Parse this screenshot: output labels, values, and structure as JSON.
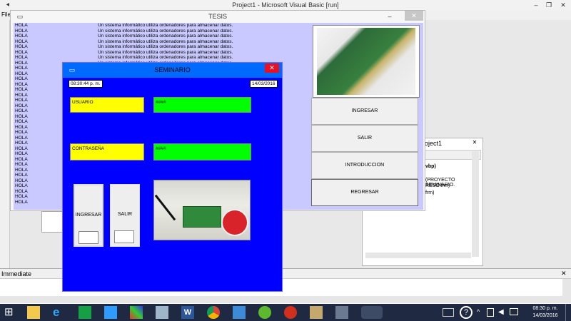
{
  "vb": {
    "title": "Project1 - Microsoft Visual Basic [run]",
    "menu_file": "File"
  },
  "tesis": {
    "title": "TESIS",
    "rows": [
      {
        "hola": "HOLA",
        "text": "Un sistema informático utiliza ordenadores para almacenar datos."
      },
      {
        "hola": "HOLA",
        "text": "Un sistema informático utiliza ordenadores para almacenar datos."
      },
      {
        "hola": "HOLA",
        "text": "Un sistema informático utiliza ordenadores para almacenar datos."
      },
      {
        "hola": "HOLA",
        "text": "Un sistema informático utiliza ordenadores para almacenar datos."
      },
      {
        "hola": "HOLA",
        "text": "Un sistema informático utiliza ordenadores para almacenar datos."
      },
      {
        "hola": "HOLA",
        "text": "Un sistema informático utiliza ordenadores para almacenar datos."
      },
      {
        "hola": "HOLA",
        "text": "Un sistema informático utiliza ordenadores para almacenar datos."
      },
      {
        "hola": "HOLA",
        "text": "Un sistema informático utiliza ordenadores para almacenar datos."
      },
      {
        "hola": "HOLA",
        "text": ""
      },
      {
        "hola": "HOLA",
        "text": ""
      },
      {
        "hola": "HOLA",
        "text": ""
      },
      {
        "hola": "HOLA",
        "text": ""
      },
      {
        "hola": "HOLA",
        "text": ""
      },
      {
        "hola": "HOLA",
        "text": ""
      },
      {
        "hola": "HOLA",
        "text": ""
      },
      {
        "hola": "HOLA",
        "text": ""
      },
      {
        "hola": "HOLA",
        "text": ""
      },
      {
        "hola": "HOLA",
        "text": ""
      },
      {
        "hola": "HOLA",
        "text": ""
      },
      {
        "hola": "HOLA",
        "text": ""
      },
      {
        "hola": "HOLA",
        "text": ""
      },
      {
        "hola": "HOLA",
        "text": ""
      },
      {
        "hola": "HOLA",
        "text": ""
      },
      {
        "hola": "HOLA",
        "text": ""
      },
      {
        "hola": "HOLA",
        "text": ""
      },
      {
        "hola": "HOLA",
        "text": ""
      },
      {
        "hola": "HOLA",
        "text": ""
      },
      {
        "hola": "HOLA",
        "text": ""
      },
      {
        "hola": "HOLA",
        "text": ""
      },
      {
        "hola": "HOLA",
        "text": ""
      },
      {
        "hola": "HOLA",
        "text": ""
      },
      {
        "hola": "HOLA",
        "text": ""
      },
      {
        "hola": "HOLA",
        "text": ""
      },
      {
        "hola": "HOLA",
        "text": ""
      }
    ],
    "buttons": [
      "INGRESAR",
      "SALIR",
      "INTRODUCCION",
      "REGRESAR"
    ]
  },
  "project": {
    "title": "roject1",
    "lines": [
      "vbp)",
      "(PROYECTO SEMINARIO.",
      "RESO.frm)",
      "frm)"
    ]
  },
  "immediate": {
    "title": "Immediate"
  },
  "seminario": {
    "title": "SEMINARIO",
    "time": "08:30:44 p. m.",
    "date": "14/03/2016",
    "usuario_label": "USUARIO",
    "usuario_value": "####",
    "contrasena_label": "CONTRASEÑA",
    "contrasena_value": "####",
    "ingresar": "INGRESAR",
    "salir": "SALIR"
  },
  "taskbar": {
    "time": "08:30 p. m.",
    "date": "14/03/2016"
  },
  "colors": {
    "form_blue": "#0000ff",
    "field_yellow": "#ffff00",
    "field_green": "#00ff00",
    "tesis_lavender": "#c9c9ff",
    "title_accent": "#006aff",
    "close_red": "#e81123"
  }
}
